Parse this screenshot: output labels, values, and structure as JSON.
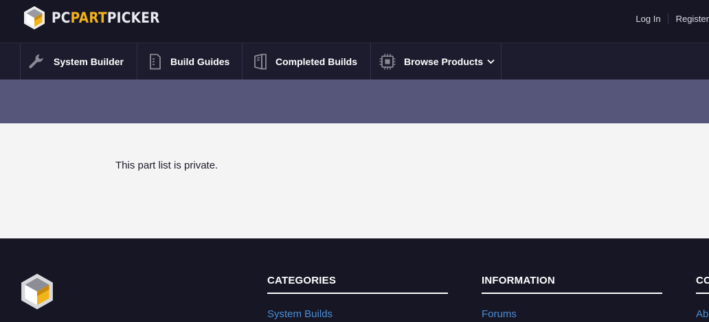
{
  "header": {
    "logo": {
      "prefix": "PC",
      "highlight": "PART",
      "suffix": "PICKER"
    },
    "auth": {
      "login": "Log In",
      "register": "Register"
    }
  },
  "nav": {
    "items": [
      {
        "label": "System Builder",
        "icon": "wrench-icon"
      },
      {
        "label": "Build Guides",
        "icon": "document-icon"
      },
      {
        "label": "Completed Builds",
        "icon": "pc-case-icon"
      },
      {
        "label": "Browse Products",
        "icon": "cpu-chip-icon"
      }
    ]
  },
  "main": {
    "message": "This part list is private."
  },
  "footer": {
    "columns": [
      {
        "heading": "CATEGORIES",
        "first_link": "System Builds"
      },
      {
        "heading": "INFORMATION",
        "first_link": "Forums"
      },
      {
        "heading": "COMPANY",
        "first_link": "About"
      }
    ]
  },
  "colors": {
    "topbar": "#161625",
    "navbar": "#1c1c2e",
    "banner": "#56567a",
    "content": "#f4f4f5",
    "accent": "#f2b31b",
    "link": "#4b8fd6"
  }
}
